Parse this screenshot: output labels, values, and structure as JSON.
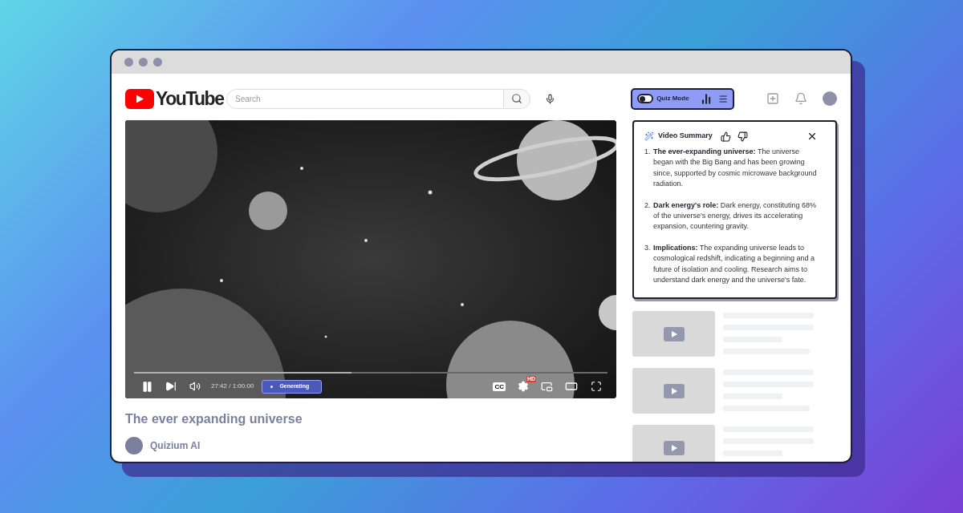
{
  "logo": {
    "text": "YouTube"
  },
  "search": {
    "placeholder": "Search"
  },
  "quiz_mode": {
    "label": "Quiz Mode",
    "on": false
  },
  "video": {
    "progress": {
      "level": 0.46
    },
    "time": "27:42 / 1:00:00",
    "status": "Generating",
    "cc_label": "CC",
    "quality_badge": "HD"
  },
  "video_title": "The ever expanding universe",
  "channel": {
    "name": "Quizium AI"
  },
  "summary": {
    "title": "Video Summary",
    "items": [
      {
        "number": "1.",
        "heading": "The ever-expanding universe:",
        "text": "The universe began with the Big Bang and has been growing since, supported by cosmic microwave background radiation."
      },
      {
        "number": "2.",
        "heading": "Dark energy's role:",
        "text": "Dark energy, constituting 68% of the universe's energy, drives its accelerating expansion, countering gravity."
      },
      {
        "number": "3.",
        "heading": "Implications:",
        "text": "The expanding universe leads to cosmological redshift, indicating a beginning and a future of isolation and cooling. Research aims to understand dark energy and the universe's fate."
      }
    ]
  },
  "recommendations": [
    {
      "kind": "skeleton",
      "lines": [
        {
          "kind": "long"
        },
        {
          "kind": "long"
        },
        {
          "kind": "short"
        },
        {
          "kind": "medium"
        }
      ]
    },
    {
      "kind": "skeleton",
      "lines": [
        {
          "kind": "long"
        },
        {
          "kind": "long"
        },
        {
          "kind": "short"
        },
        {
          "kind": "medium"
        }
      ]
    },
    {
      "kind": "skeleton",
      "lines": [
        {
          "kind": "long"
        },
        {
          "kind": "long"
        },
        {
          "kind": "short"
        }
      ]
    }
  ]
}
